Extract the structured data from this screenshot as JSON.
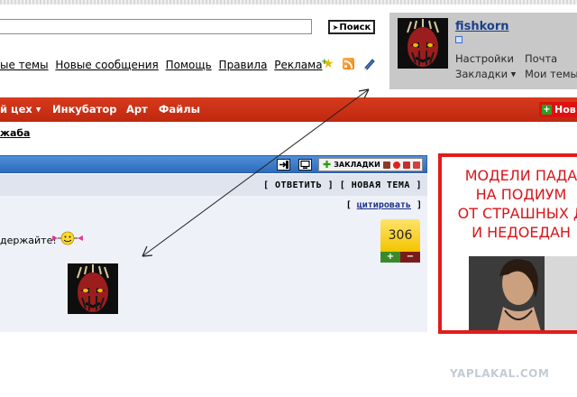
{
  "search": {
    "button_label": "Поиск"
  },
  "toplinks": [
    "ые темы",
    "Новые сообщения",
    "Помощь",
    "Правила",
    "Реклама"
  ],
  "user": {
    "name": "fishkorn",
    "links": [
      "Настройки",
      "Почта",
      "Закладки",
      "Мои темы"
    ]
  },
  "nav": {
    "items": [
      "й цех",
      "Инкубатор",
      "Арт",
      "Файлы"
    ],
    "new_label": "Нов"
  },
  "breadcrumb": "жаба",
  "post": {
    "bookmarks_label": "ЗАКЛАДКИ",
    "reply_actions": "[ ОТВЕТИТЬ ] [ НОВАЯ ТЕМА ]",
    "quote_prefix": "[ ",
    "quote_label": "цитировать",
    "quote_suffix": " ]",
    "text": "держайте!",
    "rating": "306",
    "rating_plus": "+",
    "rating_minus": "−"
  },
  "ad": {
    "text": "МОДЕЛИ ПАДА\nНА ПОДИУМ\nОТ СТРАШНЫХ Д\nИ НЕДОЕДАН"
  },
  "watermark": "YAPLAKAL.COM",
  "colors": {
    "nav_red": "#c8301a",
    "post_blue": "#3b7bd0",
    "ad_red": "#e21c1c",
    "rating_yellow": "#f4c400"
  }
}
